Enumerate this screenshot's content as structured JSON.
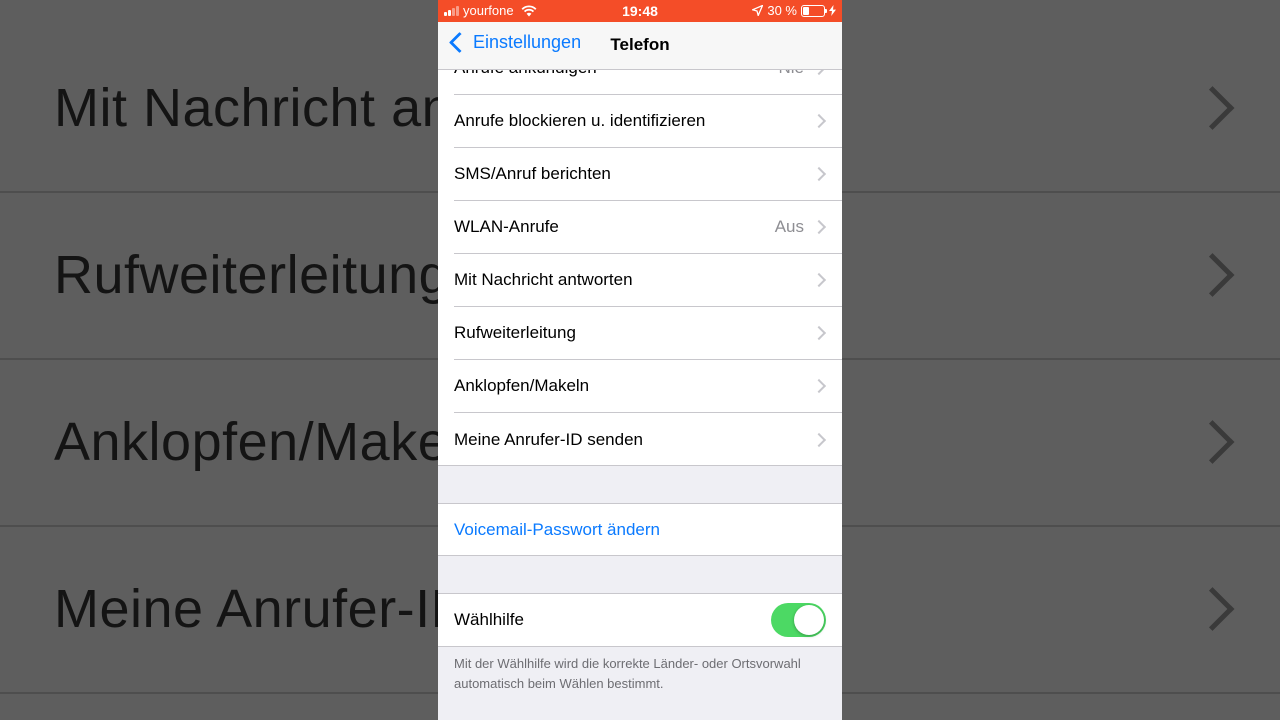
{
  "background": {
    "rows": [
      {
        "label": "Mit Nachricht antworten"
      },
      {
        "label": "Rufweiterleitung"
      },
      {
        "label": "Anklopfen/Makeln"
      },
      {
        "label": "Meine Anrufer-ID senden"
      }
    ]
  },
  "status_bar": {
    "carrier": "yourfone",
    "time": "19:48",
    "battery": "30 %",
    "color": "#f44d28"
  },
  "nav": {
    "back_label": "Einstellungen",
    "title": "Telefon"
  },
  "list": {
    "partial_row": {
      "label": "Anrufe ankündigen",
      "value": "Nie"
    },
    "rows": [
      {
        "label": "Anrufe blockieren u. identifizieren",
        "value": ""
      },
      {
        "label": "SMS/Anruf berichten",
        "value": ""
      },
      {
        "label": "WLAN-Anrufe",
        "value": "Aus"
      },
      {
        "label": "Mit Nachricht antworten",
        "value": ""
      },
      {
        "label": "Rufweiterleitung",
        "value": ""
      },
      {
        "label": "Anklopfen/Makeln",
        "value": ""
      },
      {
        "label": "Meine Anrufer-ID senden",
        "value": ""
      }
    ]
  },
  "voicemail": {
    "label": "Voicemail-Passwort ändern"
  },
  "dial_assist": {
    "label": "Wählhilfe",
    "enabled": true,
    "footnote": "Mit der Wählhilfe wird die korrekte Länder- oder Ortsvorwahl automatisch beim Wählen bestimmt."
  },
  "colors": {
    "link": "#0a7aff",
    "toggle_on": "#4cd964"
  }
}
